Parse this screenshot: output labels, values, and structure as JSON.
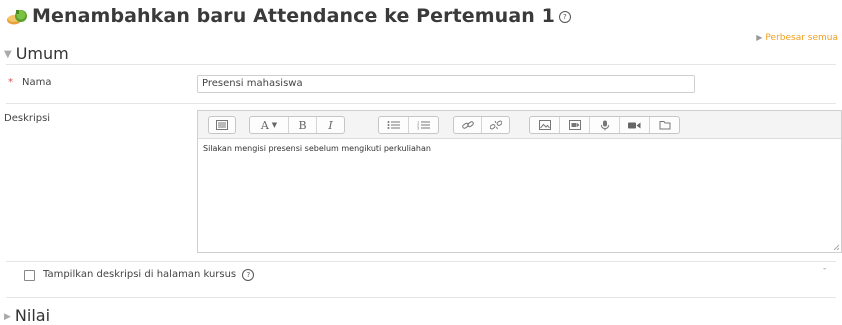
{
  "header": {
    "title": "Menambahkan baru Attendance ke Pertemuan 1",
    "help_glyph": "?",
    "module_icon": "attendance-module-icon"
  },
  "expand_all": {
    "label": "Perbesar semua"
  },
  "sections": {
    "umum": {
      "label": "Umum",
      "expanded": true
    },
    "nilai": {
      "label": "Nilai",
      "expanded": false
    }
  },
  "form": {
    "required_marker": "*",
    "nama": {
      "label": "Nama",
      "value": "Presensi mahasiswa"
    },
    "deskripsi": {
      "label": "Deskripsi",
      "content": "Silakan mengisi presensi sebelum mengikuti perkuliahan",
      "toolbar_groups": [
        [
          "toolbar-toggle-icon"
        ],
        [
          "font-style-icon",
          "bold-icon",
          "italic-icon"
        ],
        [
          "unordered-list-icon",
          "ordered-list-icon"
        ],
        [
          "link-icon",
          "unlink-icon"
        ],
        [
          "image-icon",
          "media-icon",
          "record-audio-icon",
          "record-video-icon",
          "manage-files-icon"
        ]
      ]
    },
    "show_description": {
      "label": "Tampilkan deskripsi di halaman kursus",
      "checked": false,
      "help_glyph": "?"
    },
    "stray_mark": "-"
  },
  "colors": {
    "expand_link": "#f0a020",
    "required": "#d9534f",
    "border": "#cfcfcf",
    "toolbar_bg": "#f4f4f4"
  }
}
